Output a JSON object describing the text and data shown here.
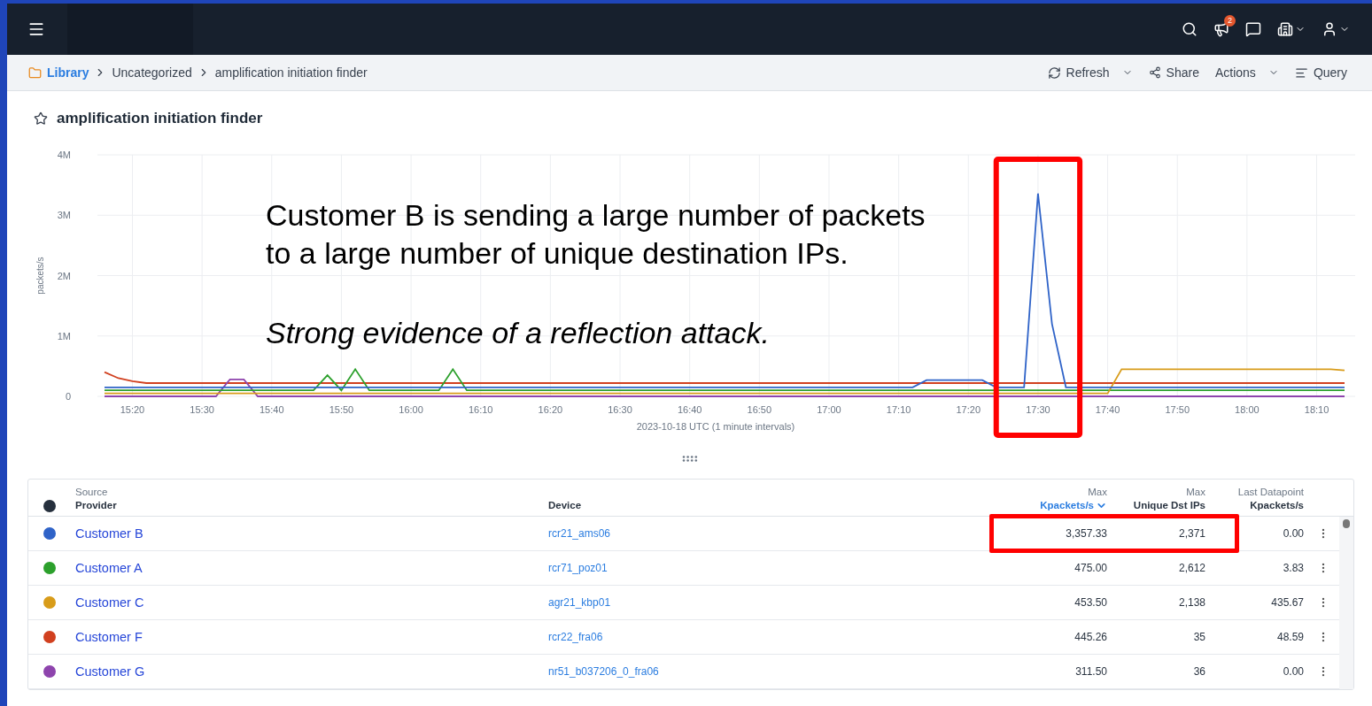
{
  "nav": {
    "badge_count": "2"
  },
  "breadcrumb": {
    "items": [
      "Library",
      "Uncategorized",
      "amplification initiation finder"
    ],
    "actions": [
      {
        "kind": "refresh",
        "label": "Refresh",
        "dropdown": true
      },
      {
        "kind": "share",
        "label": "Share",
        "dropdown": false
      },
      {
        "kind": "actions",
        "label": "Actions",
        "dropdown": true
      },
      {
        "kind": "query",
        "label": "Query",
        "dropdown": false
      }
    ]
  },
  "page_title": "amplification initiation finder",
  "annotation": {
    "lines": [
      "Customer B is sending a large number of packets",
      "to a large number of unique destination IPs."
    ],
    "conclusion": "Strong evidence of a reflection attack."
  },
  "chart_data": {
    "type": "line",
    "xlabel": "2023-10-18 UTC (1 minute intervals)",
    "ylabel": "packets/s",
    "categories": [
      null,
      null,
      "15:20",
      null,
      null,
      null,
      null,
      "15:30",
      null,
      null,
      null,
      null,
      "15:40",
      null,
      null,
      null,
      null,
      "15:50",
      null,
      null,
      null,
      null,
      "16:00",
      null,
      null,
      null,
      null,
      "16:10",
      null,
      null,
      null,
      null,
      "16:20",
      null,
      null,
      null,
      null,
      "16:30",
      null,
      null,
      null,
      null,
      "16:40",
      null,
      null,
      null,
      null,
      "16:50",
      null,
      null,
      null,
      null,
      "17:00",
      null,
      null,
      null,
      null,
      "17:10",
      null,
      null,
      null,
      null,
      "17:20",
      null,
      null,
      null,
      null,
      "17:30",
      null,
      null,
      null,
      null,
      "17:40",
      null,
      null,
      null,
      null,
      "17:50",
      null,
      null,
      null,
      null,
      "18:00",
      null,
      null,
      null,
      null,
      "18:10",
      null,
      null
    ],
    "ylim": [
      0,
      4000000
    ],
    "yticks": [
      {
        "value": 0,
        "label": "0"
      },
      {
        "value": 1000000,
        "label": "1M"
      },
      {
        "value": 2000000,
        "label": "2M"
      },
      {
        "value": 3000000,
        "label": "3M"
      },
      {
        "value": 4000000,
        "label": "4M"
      }
    ],
    "series": [
      {
        "color": "#d1401f",
        "values": [
          400000,
          300000,
          250000,
          220000,
          220000,
          220000,
          220000,
          220000,
          220000,
          220000,
          220000,
          220000,
          220000,
          220000,
          220000,
          220000,
          220000,
          220000,
          220000,
          220000,
          220000,
          220000,
          220000,
          220000,
          220000,
          220000,
          220000,
          220000,
          220000,
          220000,
          220000,
          220000,
          220000,
          220000,
          220000,
          220000,
          220000,
          220000,
          220000,
          220000,
          220000,
          220000,
          220000,
          220000,
          220000,
          220000,
          220000,
          220000,
          220000,
          220000,
          220000,
          220000,
          220000,
          220000,
          220000,
          220000,
          220000,
          220000,
          220000,
          220000,
          220000,
          220000,
          220000,
          220000,
          220000,
          220000,
          220000,
          220000,
          220000,
          220000,
          220000,
          220000,
          220000,
          220000,
          220000,
          220000,
          220000,
          220000,
          220000,
          220000,
          220000,
          220000,
          220000,
          220000,
          220000,
          220000,
          220000,
          220000,
          220000,
          220000
        ]
      },
      {
        "color": "#8e44ad",
        "values": [
          0,
          0,
          0,
          0,
          0,
          0,
          0,
          0,
          0,
          280000,
          280000,
          0,
          0,
          0,
          0,
          0,
          0,
          0,
          0,
          0,
          0,
          0,
          0,
          0,
          0,
          0,
          0,
          0,
          0,
          0,
          0,
          0,
          0,
          0,
          0,
          0,
          0,
          0,
          0,
          0,
          0,
          0,
          0,
          0,
          0,
          0,
          0,
          0,
          0,
          0,
          0,
          0,
          0,
          0,
          0,
          0,
          0,
          0,
          0,
          0,
          0,
          0,
          0,
          0,
          0,
          0,
          0,
          0,
          0,
          0,
          0,
          0,
          0,
          0,
          0,
          0,
          0,
          0,
          0,
          0,
          0,
          0,
          0,
          0,
          0,
          0,
          0,
          0,
          0,
          0
        ]
      },
      {
        "color": "#2ca02c",
        "values": [
          100000,
          100000,
          100000,
          100000,
          100000,
          100000,
          100000,
          100000,
          100000,
          100000,
          100000,
          100000,
          100000,
          100000,
          100000,
          100000,
          350000,
          100000,
          450000,
          100000,
          100000,
          100000,
          100000,
          100000,
          100000,
          450000,
          100000,
          100000,
          100000,
          100000,
          100000,
          100000,
          100000,
          100000,
          100000,
          100000,
          100000,
          100000,
          100000,
          100000,
          100000,
          100000,
          100000,
          100000,
          100000,
          100000,
          100000,
          100000,
          100000,
          100000,
          100000,
          100000,
          100000,
          100000,
          100000,
          100000,
          100000,
          100000,
          100000,
          100000,
          100000,
          100000,
          100000,
          100000,
          100000,
          100000,
          100000,
          100000,
          100000,
          100000,
          100000,
          100000,
          100000,
          100000,
          100000,
          100000,
          100000,
          100000,
          100000,
          100000,
          100000,
          100000,
          100000,
          100000,
          100000,
          100000,
          100000,
          100000,
          100000,
          100000
        ]
      },
      {
        "color": "#d89c1a",
        "values": [
          50000,
          50000,
          50000,
          50000,
          50000,
          50000,
          50000,
          50000,
          50000,
          50000,
          50000,
          50000,
          50000,
          50000,
          50000,
          50000,
          50000,
          50000,
          50000,
          50000,
          50000,
          50000,
          50000,
          50000,
          50000,
          50000,
          50000,
          50000,
          50000,
          50000,
          50000,
          50000,
          50000,
          50000,
          50000,
          50000,
          50000,
          50000,
          50000,
          50000,
          50000,
          50000,
          50000,
          50000,
          50000,
          50000,
          50000,
          50000,
          50000,
          50000,
          50000,
          50000,
          50000,
          50000,
          50000,
          50000,
          50000,
          50000,
          50000,
          50000,
          50000,
          50000,
          50000,
          50000,
          50000,
          50000,
          50000,
          50000,
          50000,
          50000,
          50000,
          50000,
          50000,
          450000,
          450000,
          450000,
          450000,
          450000,
          450000,
          450000,
          450000,
          450000,
          450000,
          450000,
          450000,
          450000,
          450000,
          450000,
          450000,
          430000
        ]
      },
      {
        "color": "#2f63c8",
        "values": [
          150000,
          150000,
          150000,
          150000,
          150000,
          150000,
          150000,
          150000,
          150000,
          150000,
          150000,
          150000,
          150000,
          150000,
          150000,
          150000,
          150000,
          150000,
          150000,
          150000,
          150000,
          150000,
          150000,
          150000,
          150000,
          150000,
          150000,
          150000,
          150000,
          150000,
          150000,
          150000,
          150000,
          150000,
          150000,
          150000,
          150000,
          150000,
          150000,
          150000,
          150000,
          150000,
          150000,
          150000,
          150000,
          150000,
          150000,
          150000,
          150000,
          150000,
          150000,
          150000,
          150000,
          150000,
          150000,
          150000,
          150000,
          150000,
          150000,
          270000,
          270000,
          270000,
          270000,
          270000,
          150000,
          150000,
          150000,
          3360000,
          1200000,
          150000,
          150000,
          150000,
          150000,
          150000,
          150000,
          150000,
          150000,
          150000,
          150000,
          150000,
          150000,
          150000,
          150000,
          150000,
          150000,
          150000,
          150000,
          150000,
          150000,
          150000
        ]
      }
    ],
    "grid": true
  },
  "table": {
    "columns": [
      {
        "kind": "dot"
      },
      {
        "kind": "text",
        "lines": [
          "Source",
          "Provider"
        ],
        "sorted": false
      },
      {
        "kind": "text",
        "lines": [
          "Device"
        ],
        "sorted": false
      },
      {
        "kind": "num",
        "lines": [
          "Max",
          "Kpackets/s"
        ],
        "sorted": true
      },
      {
        "kind": "num",
        "lines": [
          "Max",
          "Unique Dst IPs"
        ],
        "sorted": false
      },
      {
        "kind": "num",
        "lines": [
          "Last Datapoint",
          "Kpackets/s"
        ],
        "sorted": false
      },
      {
        "kind": "menu"
      }
    ],
    "rows": [
      {
        "color": "#2f63c8",
        "provider": "Customer B",
        "device": "rcr21_ams06",
        "max_kpps": "3,357.33",
        "max_unique_dst": "2,371",
        "last_kpps": "0.00",
        "highlighted": true
      },
      {
        "color": "#2ca02c",
        "provider": "Customer A",
        "device": "rcr71_poz01",
        "max_kpps": "475.00",
        "max_unique_dst": "2,612",
        "last_kpps": "3.83",
        "highlighted": false
      },
      {
        "color": "#d89c1a",
        "provider": "Customer C",
        "device": "agr21_kbp01",
        "max_kpps": "453.50",
        "max_unique_dst": "2,138",
        "last_kpps": "435.67",
        "highlighted": false
      },
      {
        "color": "#d1401f",
        "provider": "Customer F",
        "device": "rcr22_fra06",
        "max_kpps": "445.26",
        "max_unique_dst": "35",
        "last_kpps": "48.59",
        "highlighted": false
      },
      {
        "color": "#8e44ad",
        "provider": "Customer G",
        "device": "nr51_b037206_0_fra06",
        "max_kpps": "311.50",
        "max_unique_dst": "36",
        "last_kpps": "0.00",
        "highlighted": false
      }
    ]
  }
}
